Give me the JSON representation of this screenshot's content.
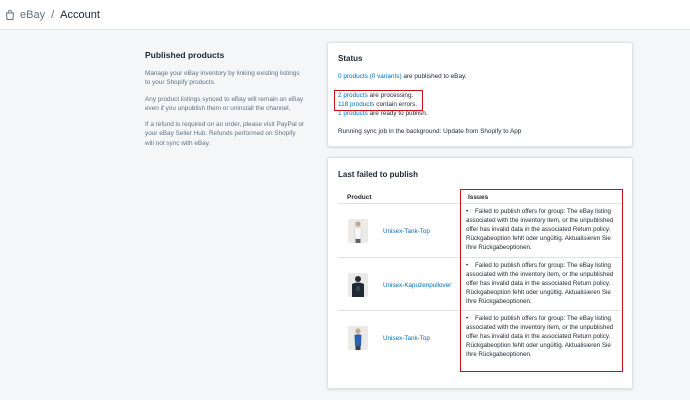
{
  "header": {
    "app_name": "eBay",
    "separator": "/",
    "page_title": "Account"
  },
  "sidebar": {
    "title": "Published products",
    "paragraphs": [
      "Manage your eBay inventory by linking existing listings to your Shopify products.",
      "Any product listings synced to eBay will remain on eBay even if you unpublish them or uninstall the channel.",
      "If a refund is required on an order, please visit PayPal or your eBay Seller Hub. Refunds performed on Shopify will not sync with eBay."
    ]
  },
  "status": {
    "title": "Status",
    "published": {
      "link": "0 products (0 variants)",
      "rest": " are published to eBay."
    },
    "processing": {
      "link": "2 products",
      "rest": " are processing."
    },
    "errors": {
      "link": "118 products",
      "rest": " contain errors."
    },
    "ready": {
      "link": "1 products",
      "rest": " are ready to publish."
    },
    "sync_job": "Running sync job in the background: Update from Shopify to App"
  },
  "failed": {
    "title": "Last failed to publish",
    "col_product": "Product",
    "col_issues": "Issues",
    "rows": [
      {
        "product": "Unisex-Tank-Top",
        "issue": "Failed to publish offers for group: The eBay listing associated with the inventory item, or the unpublished offer has invalid data in the associated Return policy. Rückgabeoption fehlt oder ungültig. Aktualisieren Sie Ihre Rückgabeoptionen."
      },
      {
        "product": "Unisex-Kapuzenpullover",
        "issue": "Failed to publish offers for group: The eBay listing associated with the inventory item, or the unpublished offer has invalid data in the associated Return policy. Rückgabeoption fehlt oder ungültig. Aktualisieren Sie Ihre Rückgabeoptionen."
      },
      {
        "product": "Unisex-Tank-Top",
        "issue": "Failed to publish offers for group: The eBay listing associated with the inventory item, or the unpublished offer has invalid data in the associated Return policy. Rückgabeoption fehlt oder ungültig. Aktualisieren Sie Ihre Rückgabeoptionen."
      }
    ]
  },
  "colors": {
    "link": "#006fbb",
    "highlight": "#c4141b",
    "background": "#f4f6f8"
  }
}
